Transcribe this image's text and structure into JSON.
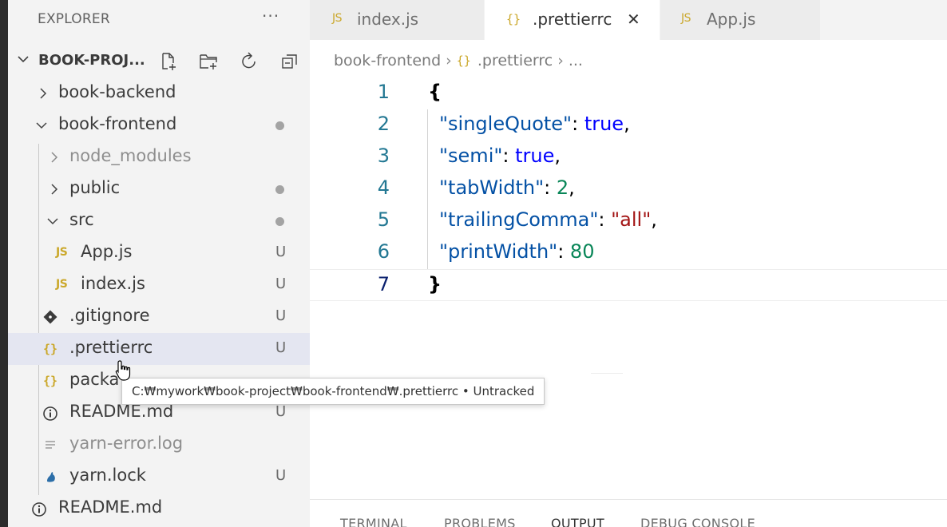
{
  "explorer": {
    "title": "EXPLORER",
    "more": "···",
    "project_name": "BOOK-PROJ..."
  },
  "tree": [
    {
      "label": "book-backend",
      "kind": "folder",
      "expanded": false,
      "status": ""
    },
    {
      "label": "book-frontend",
      "kind": "folder",
      "expanded": true,
      "status": "dot"
    },
    {
      "label": "node_modules",
      "kind": "folder",
      "expanded": false,
      "status": ""
    },
    {
      "label": "public",
      "kind": "folder",
      "expanded": false,
      "status": "dot"
    },
    {
      "label": "src",
      "kind": "folder",
      "expanded": true,
      "status": "dot"
    },
    {
      "label": "App.js",
      "kind": "js",
      "status": "U"
    },
    {
      "label": "index.js",
      "kind": "js",
      "status": "U"
    },
    {
      "label": ".gitignore",
      "kind": "git",
      "status": "U"
    },
    {
      "label": ".prettierrc",
      "kind": "json",
      "status": "U"
    },
    {
      "label": "packa",
      "kind": "json",
      "status": ""
    },
    {
      "label": "README.md",
      "kind": "info",
      "status": "U"
    },
    {
      "label": "yarn-error.log",
      "kind": "log",
      "status": ""
    },
    {
      "label": "yarn.lock",
      "kind": "yarn",
      "status": "U"
    },
    {
      "label": "README.md",
      "kind": "info",
      "status": ""
    }
  ],
  "tabs": [
    {
      "icon": "JS",
      "label": "index.js",
      "active": false
    },
    {
      "icon": "{}",
      "label": ".prettierrc",
      "active": true,
      "close": "✕"
    },
    {
      "icon": "JS",
      "label": "App.js",
      "active": false
    }
  ],
  "breadcrumb": {
    "folder": "book-frontend",
    "sep": "›",
    "file_icon": "{}",
    "file": ".prettierrc",
    "more": "..."
  },
  "editor": {
    "lines": [
      {
        "no": "1",
        "brace": "{"
      },
      {
        "no": "2",
        "key": "\"singleQuote\"",
        "colon": ": ",
        "value": "true",
        "value_type": "bool",
        "comma": ","
      },
      {
        "no": "3",
        "key": "\"semi\"",
        "colon": ": ",
        "value": "true",
        "value_type": "bool",
        "comma": ","
      },
      {
        "no": "4",
        "key": "\"tabWidth\"",
        "colon": ": ",
        "value": "2",
        "value_type": "num",
        "comma": ","
      },
      {
        "no": "5",
        "key": "\"trailingComma\"",
        "colon": ": ",
        "value": "\"all\"",
        "value_type": "str",
        "comma": ","
      },
      {
        "no": "6",
        "key": "\"printWidth\"",
        "colon": ": ",
        "value": "80",
        "value_type": "num",
        "comma": ""
      },
      {
        "no": "7",
        "brace": "}"
      }
    ]
  },
  "tooltip": {
    "text": "C:₩mywork₩book-project₩book-frontend₩.prettierrc • Untracked"
  },
  "panel": {
    "tabs": [
      "TERMINAL",
      "PROBLEMS",
      "OUTPUT",
      "DEBUG CONSOLE"
    ],
    "active": "OUTPUT"
  },
  "colors": {
    "json_icon": "#cba82b",
    "js_icon": "#cba82b",
    "selection": "#e4e6f1",
    "line_number": "#237893",
    "key": "#0451a5",
    "bool": "#0000ff",
    "number": "#098658",
    "string": "#a31515"
  }
}
